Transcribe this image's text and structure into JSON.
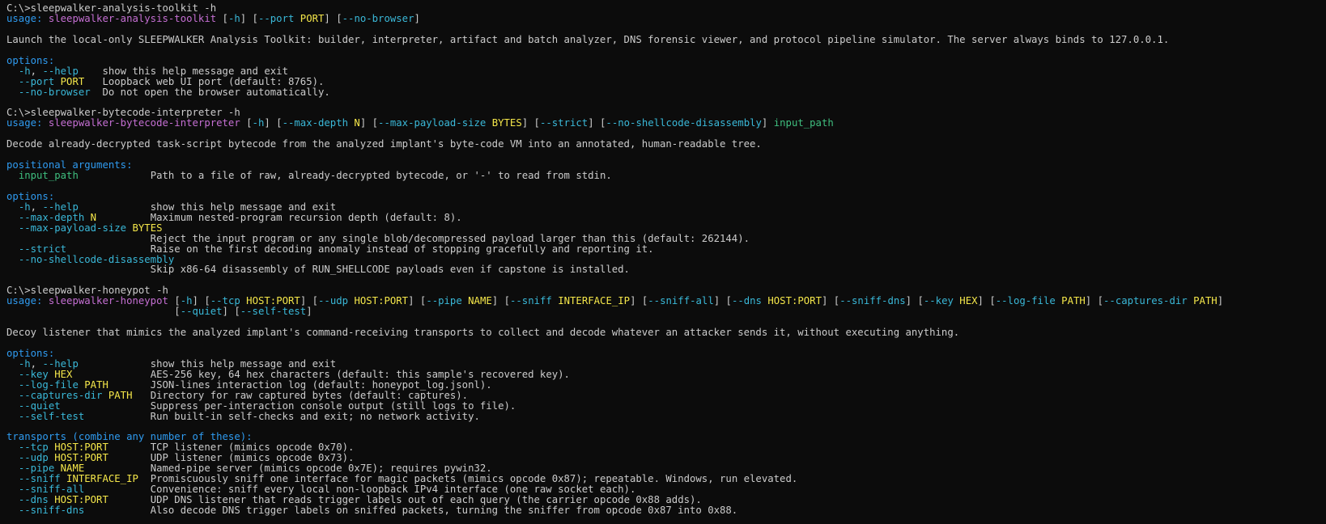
{
  "terminal": {
    "lines": [
      [
        [
          "w",
          "C:\\>sleepwalker-analysis-toolkit -h"
        ]
      ],
      [
        [
          "b",
          "usage: "
        ],
        [
          "m",
          "sleepwalker-analysis-toolkit "
        ],
        [
          "w",
          "["
        ],
        [
          "c",
          "-h"
        ],
        [
          "w",
          "] ["
        ],
        [
          "c",
          "--port "
        ],
        [
          "y",
          "PORT"
        ],
        [
          "w",
          "] ["
        ],
        [
          "c",
          "--no-browser"
        ],
        [
          "w",
          "]"
        ]
      ],
      [],
      [
        [
          "w",
          "Launch the local-only SLEEPWALKER Analysis Toolkit: builder, interpreter, artifact and batch analyzer, DNS forensic viewer, and protocol pipeline simulator. The server always binds to 127.0.0.1."
        ]
      ],
      [],
      [
        [
          "b",
          "options:"
        ]
      ],
      [
        [
          "w",
          "  "
        ],
        [
          "c",
          "-h"
        ],
        [
          "w",
          ", "
        ],
        [
          "c",
          "--help"
        ],
        [
          "w",
          "    show this help message and exit"
        ]
      ],
      [
        [
          "w",
          "  "
        ],
        [
          "c",
          "--port "
        ],
        [
          "y",
          "PORT"
        ],
        [
          "w",
          "   Loopback web UI port (default: 8765)."
        ]
      ],
      [
        [
          "w",
          "  "
        ],
        [
          "c",
          "--no-browser"
        ],
        [
          "w",
          "  Do not open the browser automatically."
        ]
      ],
      [],
      [
        [
          "w",
          "C:\\>sleepwalker-bytecode-interpreter -h"
        ]
      ],
      [
        [
          "b",
          "usage: "
        ],
        [
          "m",
          "sleepwalker-bytecode-interpreter "
        ],
        [
          "w",
          "["
        ],
        [
          "c",
          "-h"
        ],
        [
          "w",
          "] ["
        ],
        [
          "c",
          "--max-depth "
        ],
        [
          "y",
          "N"
        ],
        [
          "w",
          "] ["
        ],
        [
          "c",
          "--max-payload-size "
        ],
        [
          "y",
          "BYTES"
        ],
        [
          "w",
          "] ["
        ],
        [
          "c",
          "--strict"
        ],
        [
          "w",
          "] ["
        ],
        [
          "c",
          "--no-shellcode-disassembly"
        ],
        [
          "w",
          "] "
        ],
        [
          "g",
          "input_path"
        ]
      ],
      [],
      [
        [
          "w",
          "Decode already-decrypted task-script bytecode from the analyzed implant's byte-code VM into an annotated, human-readable tree."
        ]
      ],
      [],
      [
        [
          "b",
          "positional arguments:"
        ]
      ],
      [
        [
          "w",
          "  "
        ],
        [
          "g",
          "input_path"
        ],
        [
          "w",
          "            Path to a file of raw, already-decrypted bytecode, or '-' to read from stdin."
        ]
      ],
      [],
      [
        [
          "b",
          "options:"
        ]
      ],
      [
        [
          "w",
          "  "
        ],
        [
          "c",
          "-h"
        ],
        [
          "w",
          ", "
        ],
        [
          "c",
          "--help"
        ],
        [
          "w",
          "            show this help message and exit"
        ]
      ],
      [
        [
          "w",
          "  "
        ],
        [
          "c",
          "--max-depth "
        ],
        [
          "y",
          "N"
        ],
        [
          "w",
          "         Maximum nested-program recursion depth (default: 8)."
        ]
      ],
      [
        [
          "w",
          "  "
        ],
        [
          "c",
          "--max-payload-size "
        ],
        [
          "y",
          "BYTES"
        ]
      ],
      [
        [
          "w",
          "                        Reject the input program or any single blob/decompressed payload larger than this (default: 262144)."
        ]
      ],
      [
        [
          "w",
          "  "
        ],
        [
          "c",
          "--strict"
        ],
        [
          "w",
          "              Raise on the first decoding anomaly instead of stopping gracefully and reporting it."
        ]
      ],
      [
        [
          "w",
          "  "
        ],
        [
          "c",
          "--no-shellcode-disassembly"
        ]
      ],
      [
        [
          "w",
          "                        Skip x86-64 disassembly of RUN_SHELLCODE payloads even if capstone is installed."
        ]
      ],
      [],
      [
        [
          "w",
          "C:\\>sleepwalker-honeypot -h"
        ]
      ],
      [
        [
          "b",
          "usage: "
        ],
        [
          "m",
          "sleepwalker-honeypot "
        ],
        [
          "w",
          "["
        ],
        [
          "c",
          "-h"
        ],
        [
          "w",
          "] ["
        ],
        [
          "c",
          "--tcp "
        ],
        [
          "y",
          "HOST:PORT"
        ],
        [
          "w",
          "] ["
        ],
        [
          "c",
          "--udp "
        ],
        [
          "y",
          "HOST:PORT"
        ],
        [
          "w",
          "] ["
        ],
        [
          "c",
          "--pipe "
        ],
        [
          "y",
          "NAME"
        ],
        [
          "w",
          "] ["
        ],
        [
          "c",
          "--sniff "
        ],
        [
          "y",
          "INTERFACE_IP"
        ],
        [
          "w",
          "] ["
        ],
        [
          "c",
          "--sniff-all"
        ],
        [
          "w",
          "] ["
        ],
        [
          "c",
          "--dns "
        ],
        [
          "y",
          "HOST:PORT"
        ],
        [
          "w",
          "] ["
        ],
        [
          "c",
          "--sniff-dns"
        ],
        [
          "w",
          "] ["
        ],
        [
          "c",
          "--key "
        ],
        [
          "y",
          "HEX"
        ],
        [
          "w",
          "] ["
        ],
        [
          "c",
          "--log-file "
        ],
        [
          "y",
          "PATH"
        ],
        [
          "w",
          "] ["
        ],
        [
          "c",
          "--captures-dir "
        ],
        [
          "y",
          "PATH"
        ],
        [
          "w",
          "]"
        ]
      ],
      [
        [
          "w",
          "                            ["
        ],
        [
          "c",
          "--quiet"
        ],
        [
          "w",
          "] ["
        ],
        [
          "c",
          "--self-test"
        ],
        [
          "w",
          "]"
        ]
      ],
      [],
      [
        [
          "w",
          "Decoy listener that mimics the analyzed implant's command-receiving transports to collect and decode whatever an attacker sends it, without executing anything."
        ]
      ],
      [],
      [
        [
          "b",
          "options:"
        ]
      ],
      [
        [
          "w",
          "  "
        ],
        [
          "c",
          "-h"
        ],
        [
          "w",
          ", "
        ],
        [
          "c",
          "--help"
        ],
        [
          "w",
          "            show this help message and exit"
        ]
      ],
      [
        [
          "w",
          "  "
        ],
        [
          "c",
          "--key "
        ],
        [
          "y",
          "HEX"
        ],
        [
          "w",
          "             AES-256 key, 64 hex characters (default: this sample's recovered key)."
        ]
      ],
      [
        [
          "w",
          "  "
        ],
        [
          "c",
          "--log-file "
        ],
        [
          "y",
          "PATH"
        ],
        [
          "w",
          "       JSON-lines interaction log (default: honeypot_log.jsonl)."
        ]
      ],
      [
        [
          "w",
          "  "
        ],
        [
          "c",
          "--captures-dir "
        ],
        [
          "y",
          "PATH"
        ],
        [
          "w",
          "   Directory for raw captured bytes (default: captures)."
        ]
      ],
      [
        [
          "w",
          "  "
        ],
        [
          "c",
          "--quiet"
        ],
        [
          "w",
          "               Suppress per-interaction console output (still logs to file)."
        ]
      ],
      [
        [
          "w",
          "  "
        ],
        [
          "c",
          "--self-test"
        ],
        [
          "w",
          "           Run built-in self-checks and exit; no network activity."
        ]
      ],
      [],
      [
        [
          "b",
          "transports (combine any number of these):"
        ]
      ],
      [
        [
          "w",
          "  "
        ],
        [
          "c",
          "--tcp "
        ],
        [
          "y",
          "HOST:PORT"
        ],
        [
          "w",
          "       TCP listener (mimics opcode 0x70)."
        ]
      ],
      [
        [
          "w",
          "  "
        ],
        [
          "c",
          "--udp "
        ],
        [
          "y",
          "HOST:PORT"
        ],
        [
          "w",
          "       UDP listener (mimics opcode 0x73)."
        ]
      ],
      [
        [
          "w",
          "  "
        ],
        [
          "c",
          "--pipe "
        ],
        [
          "y",
          "NAME"
        ],
        [
          "w",
          "           Named-pipe server (mimics opcode 0x7E); requires pywin32."
        ]
      ],
      [
        [
          "w",
          "  "
        ],
        [
          "c",
          "--sniff "
        ],
        [
          "y",
          "INTERFACE_IP"
        ],
        [
          "w",
          "  Promiscuously sniff one interface for magic packets (mimics opcode 0x87); repeatable. Windows, run elevated."
        ]
      ],
      [
        [
          "w",
          "  "
        ],
        [
          "c",
          "--sniff-all"
        ],
        [
          "w",
          "           Convenience: sniff every local non-loopback IPv4 interface (one raw socket each)."
        ]
      ],
      [
        [
          "w",
          "  "
        ],
        [
          "c",
          "--dns "
        ],
        [
          "y",
          "HOST:PORT"
        ],
        [
          "w",
          "       UDP DNS listener that reads trigger labels out of each query (the carrier opcode 0x88 adds)."
        ]
      ],
      [
        [
          "w",
          "  "
        ],
        [
          "c",
          "--sniff-dns"
        ],
        [
          "w",
          "           Also decode DNS trigger labels on sniffed packets, turning the sniffer from opcode 0x87 into 0x88."
        ]
      ]
    ]
  }
}
